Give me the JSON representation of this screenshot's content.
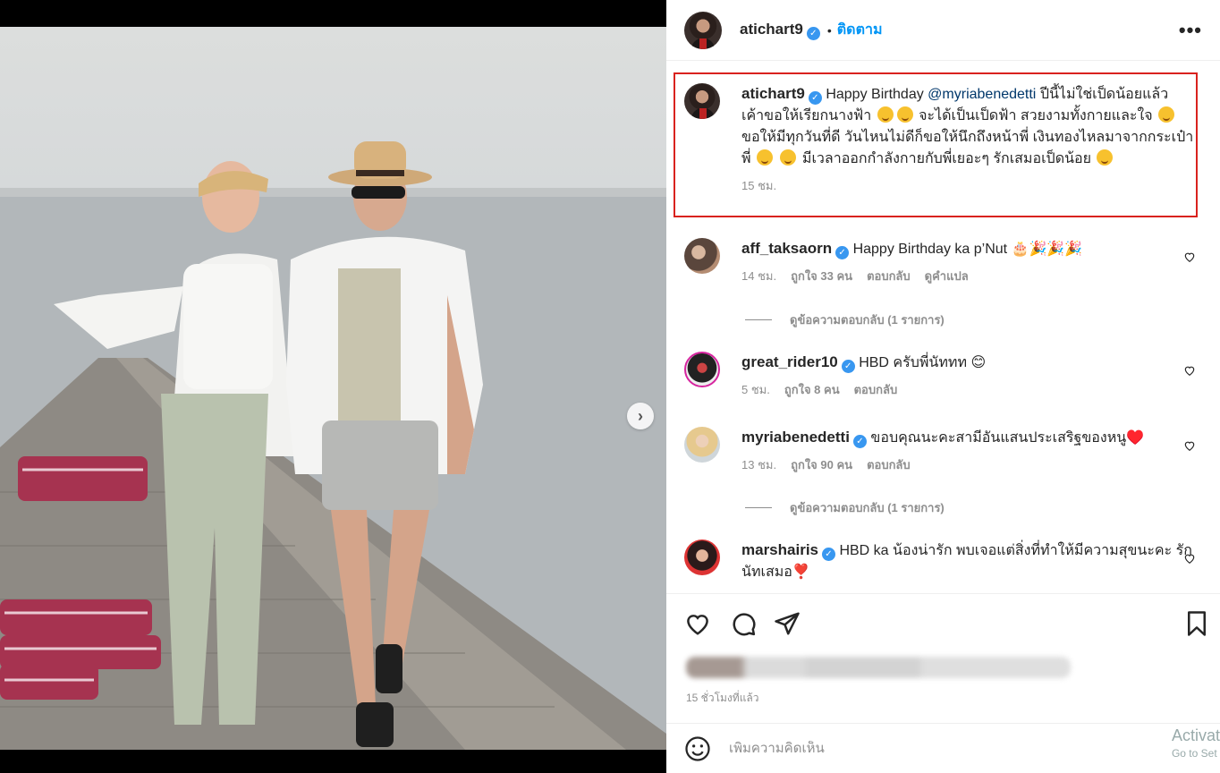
{
  "post": {
    "username": "atichart9",
    "follow_label": "ติดตาม",
    "more_label": "•••"
  },
  "caption": {
    "username": "atichart9",
    "text_1": "Happy Birthday",
    "mention": "@myriabenedetti",
    "text_2": "ปีนี้ไม่ใช่เป็ดน้อยแล้ว เค้าขอให้เรียกนางฟ้า",
    "text_3": "จะได้เป็นเป็ดฟ้า สวยงามทั้งกายและใจ",
    "text_4": "ขอให้มีทุกวันที่ดี วันไหนไม่ดีก็ขอให้นึกถึงหน้าพี่ เงินทองไหลมาจากกระเป๋าพี่",
    "text_5": "มีเวลาออกกำลังกายกับพี่เยอะๆ รักเสมอเป็ดน้อย",
    "time": "15 ชม."
  },
  "comments": [
    {
      "username": "aff_taksaorn",
      "text": "Happy Birthday ka p’Nut 🎂🎉🎉🎉",
      "time": "14 ชม.",
      "likes": "ถูกใจ 33 คน",
      "reply": "ตอบกลับ",
      "translate": "ดูคำแปล",
      "view_replies": "ดูข้อความตอบกลับ (1 รายการ)"
    },
    {
      "username": "great_rider10",
      "text": "HBD ครับพี่นัททท 😊",
      "time": "5 ชม.",
      "likes": "ถูกใจ 8 คน",
      "reply": "ตอบกลับ"
    },
    {
      "username": "myriabenedetti",
      "text": "ขอบคุณนะคะสามีอันแสนประเสริฐของหนู♥️",
      "time": "13 ชม.",
      "likes": "ถูกใจ 90 คน",
      "reply": "ตอบกลับ",
      "view_replies": "ดูข้อความตอบกลับ (1 รายการ)"
    },
    {
      "username": "marshairis",
      "text": "HBD ka น้องน่ารัก พบเจอแต่สิ่งที่ทำให้มีความสุขนะคะ รักนัทเสมอ❣️"
    }
  ],
  "footer": {
    "time_ago": "15 ชั่วโมงที่แล้ว",
    "comment_placeholder": "เพิ่มความคิดเห็น",
    "watermark_line1": "Activat",
    "watermark_line2": "Go to Set"
  },
  "colors": {
    "accent": "#0095f6",
    "highlight_border": "#d9221e",
    "verified": "#3897f0"
  },
  "carousel": {
    "slides": 8,
    "active": 1
  }
}
